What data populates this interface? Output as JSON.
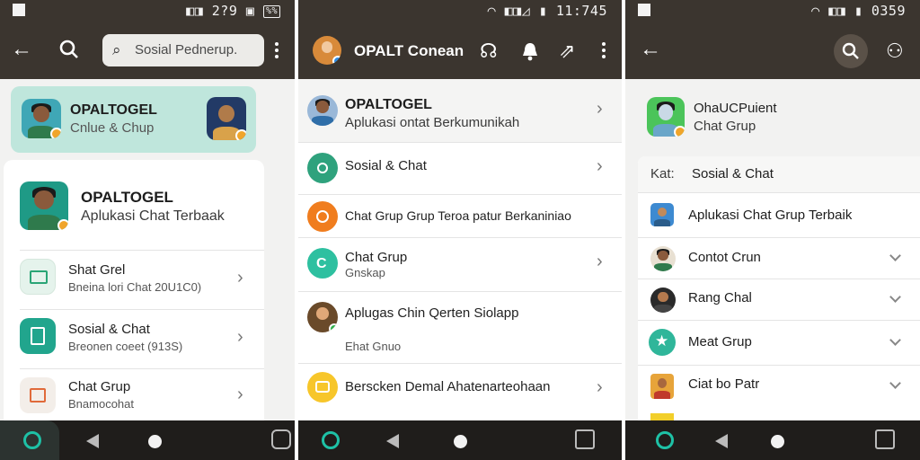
{
  "colors": {
    "appbar": "#3b352f",
    "accent": "#1ec1a6",
    "highlight_card": "#bfe6dc",
    "navbar": "#1f1d1b"
  },
  "panel1": {
    "status": {
      "time": "2?9",
      "battery": "%%"
    },
    "search": {
      "placeholder": "Sosial Pednerup."
    },
    "highlight": {
      "title": "OPALTOGEL",
      "subtitle": "Cnlue & Chup"
    },
    "profile": {
      "title": "OPALTOGEL",
      "subtitle": "Aplukasi Chat Terbaak"
    },
    "items": [
      {
        "title": "Shat Grel",
        "subtitle": "Bneina lori Chat 20U1C0)",
        "icon": "folder-icon"
      },
      {
        "title": "Sosial & Chat",
        "subtitle": "Breonen coeet (913S)",
        "icon": "bookmark-icon"
      },
      {
        "title": "Chat Grup",
        "subtitle": "Bnamocohat",
        "icon": "box-icon"
      }
    ],
    "icons": {
      "back": "back-arrow-icon",
      "search": "search-icon",
      "more": "more-vert-icon"
    }
  },
  "panel2": {
    "status": {
      "time": "11:745"
    },
    "header": {
      "title": "OPALT Conean"
    },
    "items": [
      {
        "title": "OPALTOGEL",
        "subtitle": "Aplukasi ontat Berkumunikah",
        "icon": "avatar"
      },
      {
        "title": "Sosial & Chat",
        "subtitle": "",
        "icon": "chat-icon"
      },
      {
        "title": "Chat Grup Grup Teroa patur Berkaniniao",
        "subtitle": "",
        "icon": "group-icon"
      },
      {
        "title": "Chat Grup",
        "subtitle": "Gnskap",
        "icon": "c-icon"
      },
      {
        "title": "Aplugas Chin Qerten Siolapp",
        "subtitle": "Ehat Gnuo",
        "icon": "avatar"
      },
      {
        "title": "Berscken Demal Ahatenarteohaan",
        "subtitle": "",
        "icon": "message-icon"
      }
    ],
    "icons": {
      "headset": "headset-icon",
      "bell": "bell-icon",
      "share": "share-icon",
      "more": "more-vert-icon"
    }
  },
  "panel3": {
    "status": {
      "time": "0359"
    },
    "profile": {
      "title": "OhaUCPuient",
      "subtitle": "Chat Grup"
    },
    "category": {
      "label": "Kat:",
      "value": "Sosial & Chat"
    },
    "items": [
      {
        "title": "Aplukasi Chat Grup Terbaik",
        "icon": "avatar"
      },
      {
        "title": "Contot Crun",
        "icon": "avatar"
      },
      {
        "title": "Rang Chal",
        "icon": "avatar"
      },
      {
        "title": "Meat Grup",
        "icon": "star-icon"
      },
      {
        "title": "Ciat bo Patr",
        "icon": "avatar"
      }
    ],
    "icons": {
      "back": "back-arrow-icon",
      "search": "search-icon",
      "people": "people-icon"
    }
  }
}
